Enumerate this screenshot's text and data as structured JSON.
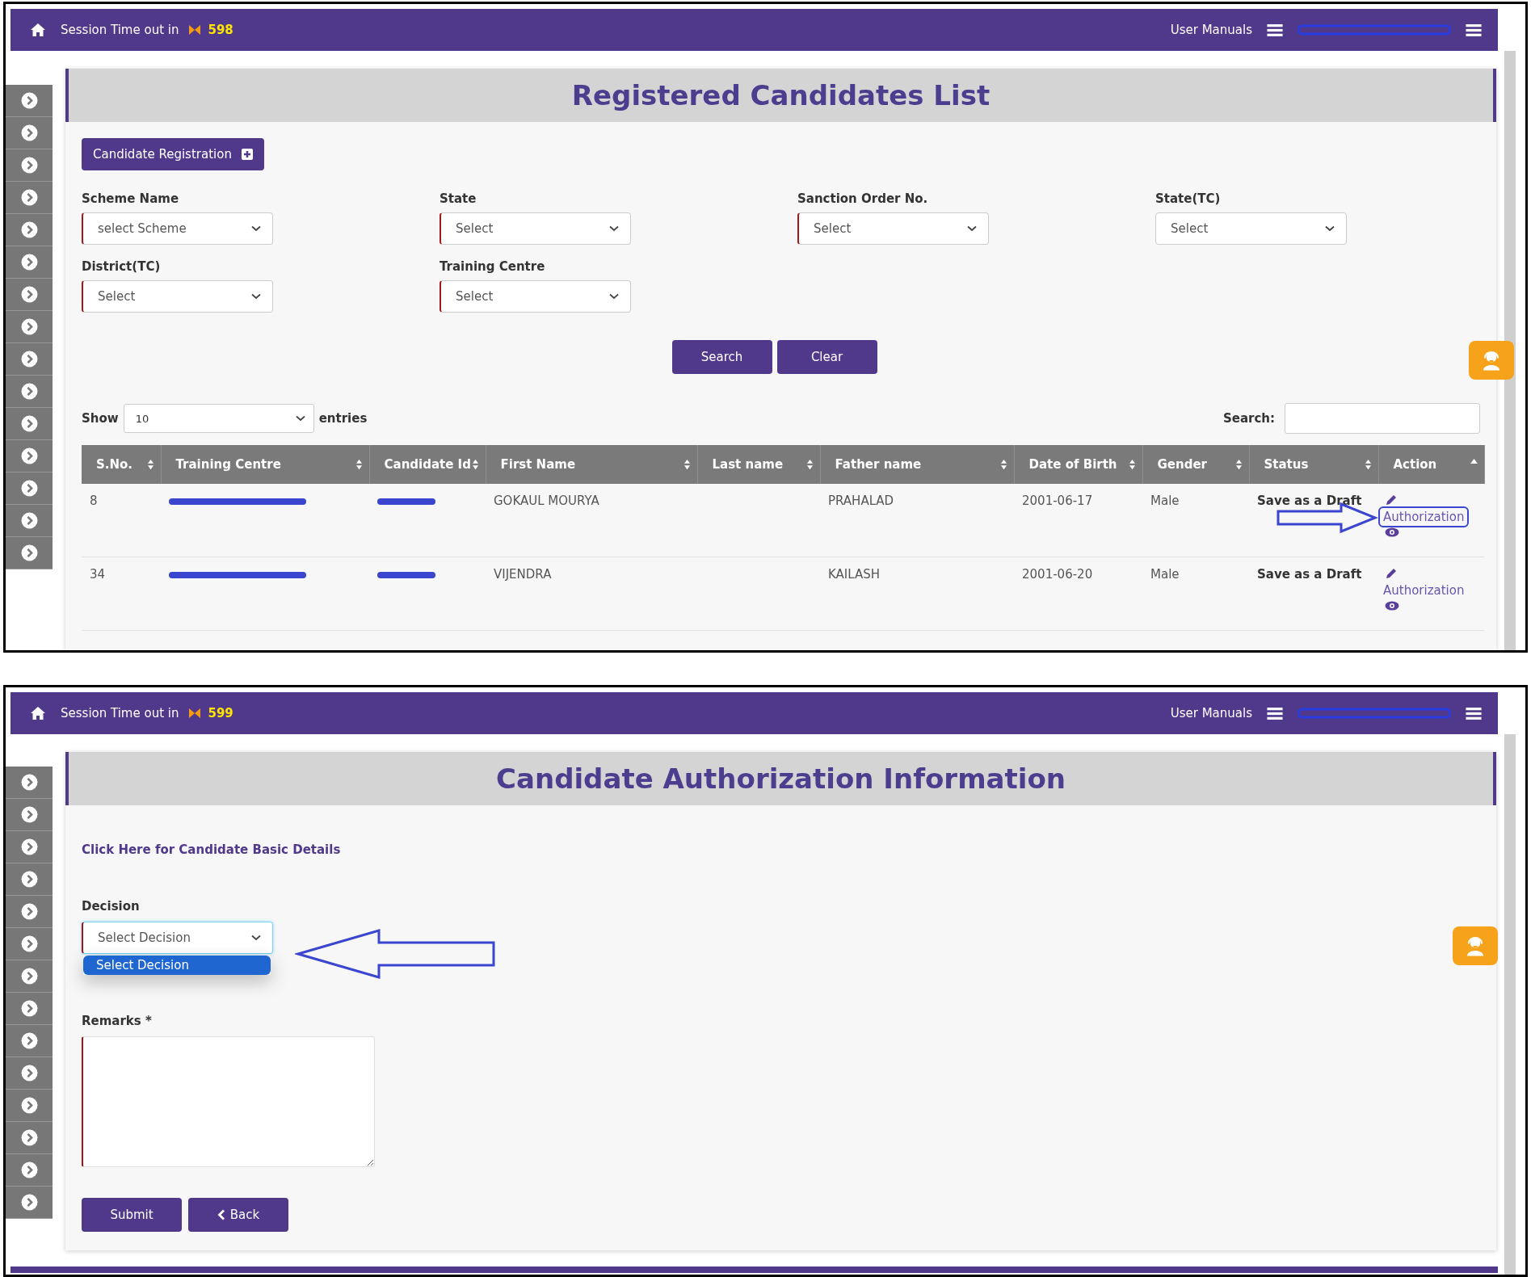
{
  "list_screen": {
    "header": {
      "session_label": "Session Time out in",
      "countdown": "598",
      "user_manuals": "User Manuals"
    },
    "title": "Registered Candidates List",
    "register_button": "Candidate Registration",
    "filters": [
      {
        "label": "Scheme Name",
        "value": "select Scheme",
        "required": true
      },
      {
        "label": "State",
        "value": "Select",
        "required": true
      },
      {
        "label": "Sanction Order No.",
        "value": "Select",
        "required": true
      },
      {
        "label": "State(TC)",
        "value": "Select",
        "required": false
      },
      {
        "label": "District(TC)",
        "value": "Select",
        "required": true
      },
      {
        "label": "Training Centre",
        "value": "Select",
        "required": true
      }
    ],
    "buttons": [
      "Search",
      "Clear"
    ],
    "length": {
      "show": "Show",
      "value": "10",
      "entries": "entries"
    },
    "search_label": "Search:",
    "table": {
      "columns": [
        {
          "label": "S.No.",
          "sorted": false
        },
        {
          "label": "Training Centre",
          "sorted": false
        },
        {
          "label": "Candidate Id",
          "sorted": false
        },
        {
          "label": "First Name",
          "sorted": false
        },
        {
          "label": "Last name",
          "sorted": false
        },
        {
          "label": "Father name",
          "sorted": false
        },
        {
          "label": "Date of Birth",
          "sorted": false
        },
        {
          "label": "Gender",
          "sorted": false
        },
        {
          "label": "Status",
          "sorted": false
        },
        {
          "label": "Action",
          "sorted": true
        }
      ],
      "rows": [
        {
          "sno": "8",
          "first_name": "GOKAUL MOURYA",
          "father_name": "PRAHALAD",
          "dob": "2001-06-17",
          "gender": "Male",
          "status": "Save as a Draft",
          "action": "Authorization",
          "highlighted": true
        },
        {
          "sno": "34",
          "first_name": "VIJENDRA",
          "father_name": "KAILASH",
          "dob": "2001-06-20",
          "gender": "Male",
          "status": "Save as a Draft",
          "action": "Authorization",
          "highlighted": false
        }
      ]
    }
  },
  "authorization_screen": {
    "header": {
      "session_label": "Session Time out in",
      "countdown": "599",
      "user_manuals": "User Manuals"
    },
    "title": "Candidate Authorization Information",
    "details_link": "Click Here for Candidate Basic Details",
    "decision": {
      "label": "Decision",
      "value": "Select Decision",
      "open": true,
      "options": [
        {
          "label": "Select Decision",
          "selected": true
        }
      ]
    },
    "remarks_label": "Remarks *",
    "buttons": [
      {
        "kind": "submit",
        "label": "Submit"
      },
      {
        "kind": "back",
        "label": "Back"
      }
    ]
  }
}
